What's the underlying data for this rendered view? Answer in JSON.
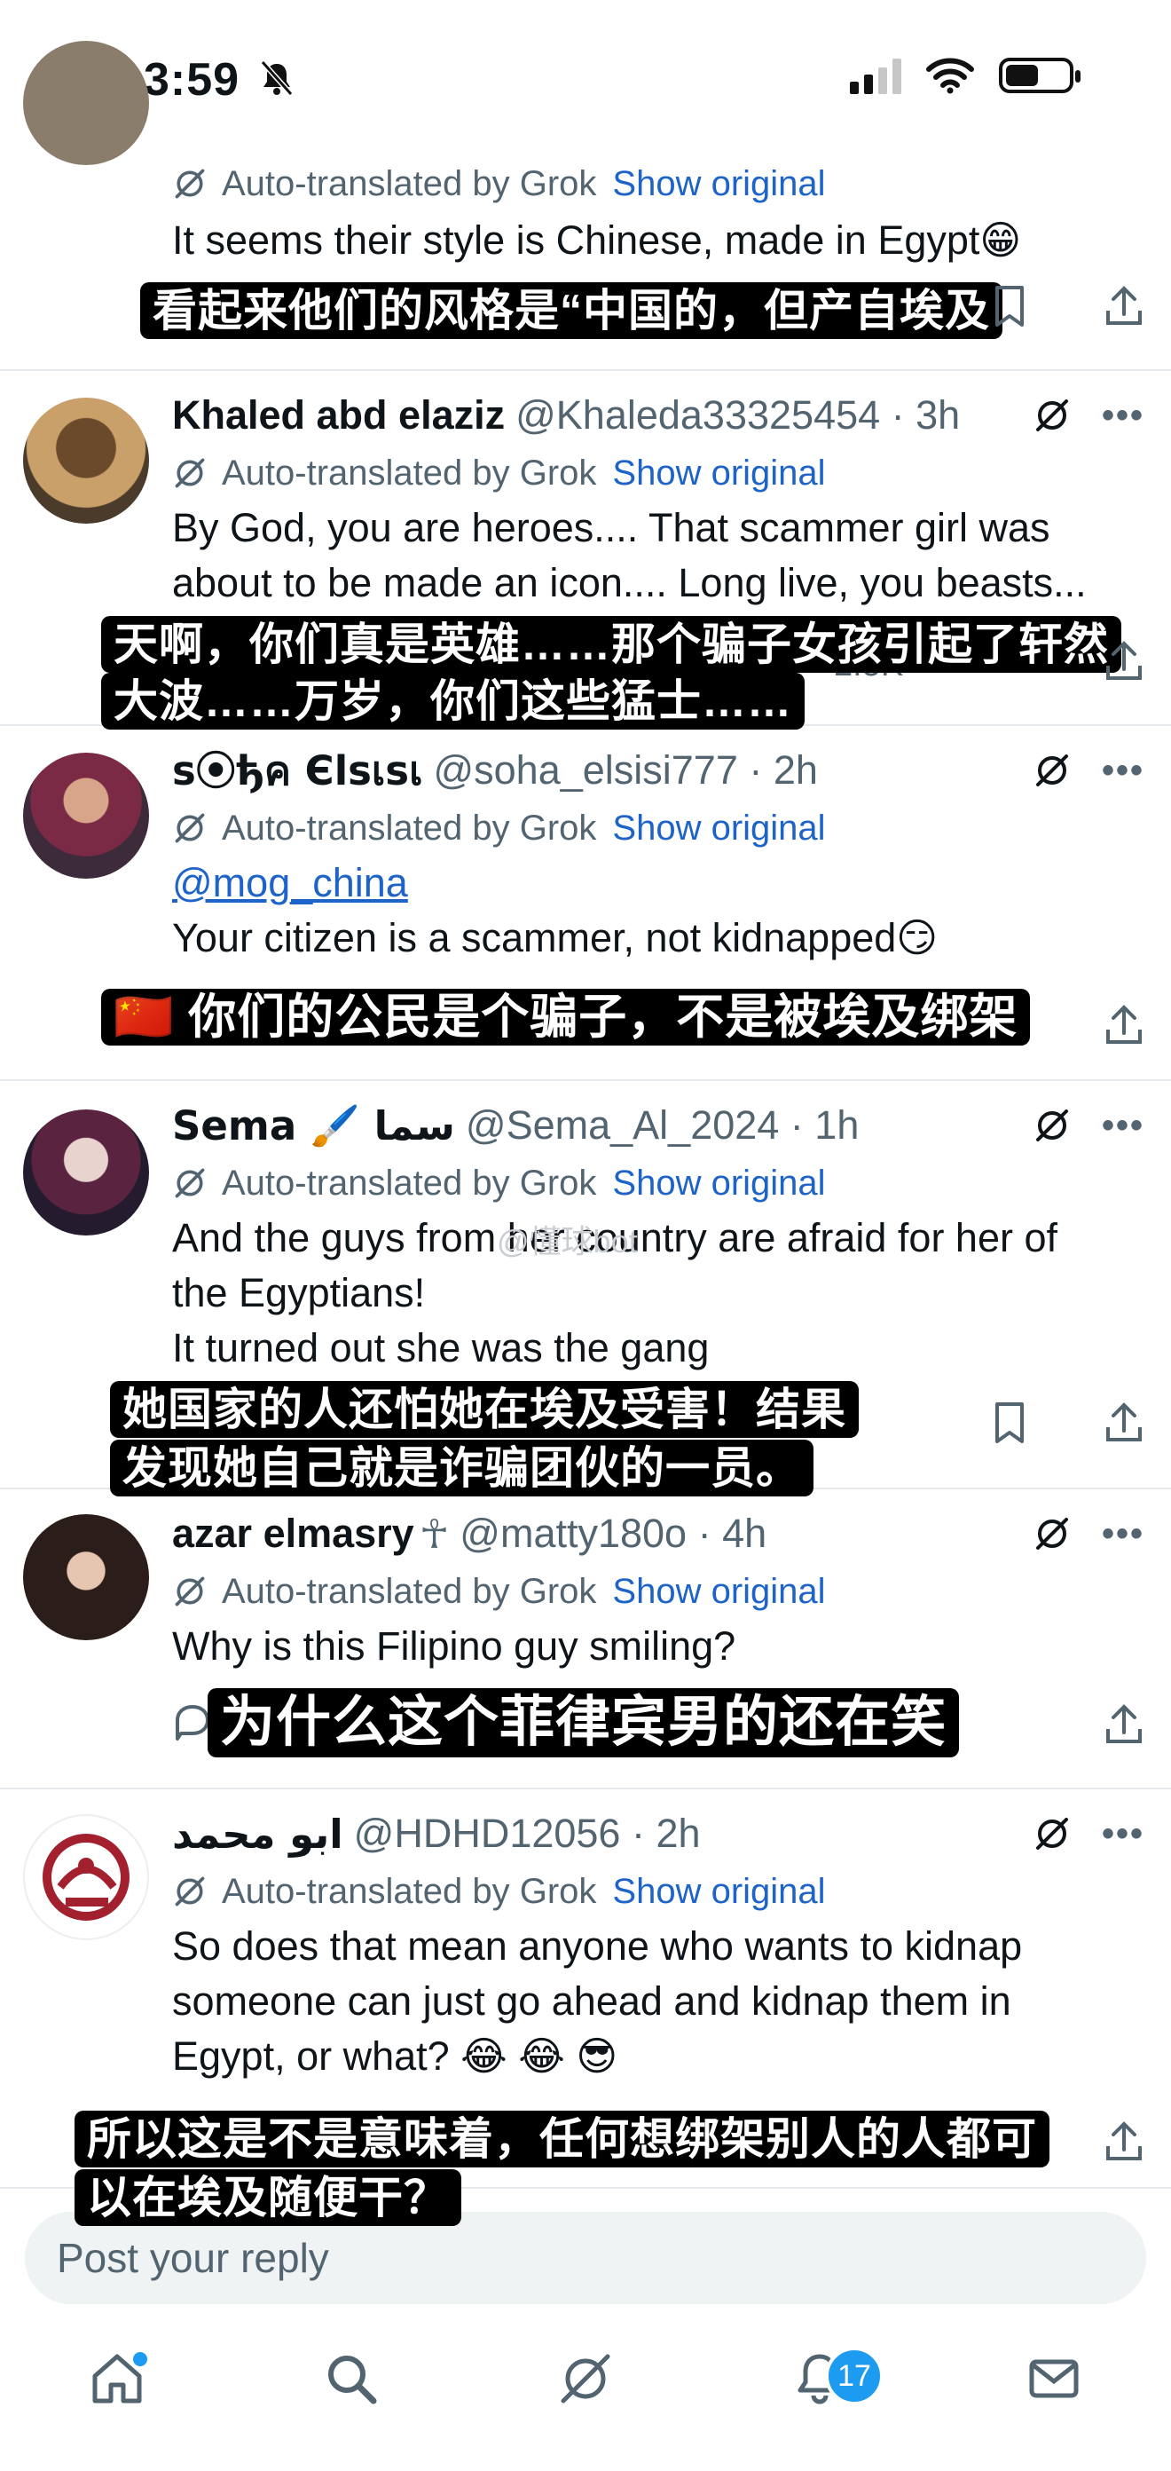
{
  "status_bar": {
    "time": "3:59"
  },
  "tweets": [
    {
      "name": "",
      "handle": "",
      "time": "",
      "auto_label": "Auto-translated by Grok",
      "show_original": "Show original",
      "body": [
        " It seems their style is Chinese, made in Egypt😁"
      ],
      "subtitle": [
        "看起来他们的风格是“中国的，但产自埃及"
      ]
    },
    {
      "name": "Khaled abd elaziz",
      "handle": "@Khaleda33325454 · 3h",
      "auto_label": "Auto-translated by Grok",
      "show_original": "Show original",
      "body": [
        " By God, you are heroes.... That scammer girl was",
        "about to be made an icon.... Long live, you beasts..."
      ],
      "subtitle": [
        "天啊，你们真是英雄……那个骗子女孩引起了轩然",
        "大波……万岁，你们这些猛士……"
      ],
      "views": "2.5K"
    },
    {
      "name": "s⦿ђค Єlsเsเ",
      "handle": "@soha_elsisi777 · 2h",
      "auto_label": "Auto-translated by Grok",
      "show_original": "Show original",
      "mention": "@mog_china",
      "body": [
        "Your citizen is a scammer, not kidnapped😏"
      ],
      "subtitle": [
        "🇨🇳 你们的公民是个骗子，不是被埃及绑架"
      ]
    },
    {
      "name": "Sema 🖌️ سما",
      "handle": "@Sema_Al_2024 · 1h",
      "auto_label": "Auto-translated by Grok",
      "show_original": "Show original",
      "body": [
        "And the guys from her country are afraid for her of",
        "the Egyptians!",
        "It turned out she was the gang"
      ],
      "subtitle": [
        "她国家的人还怕她在埃及受害！结果",
        "发现她自己就是诈骗团伙的一员。"
      ],
      "watermark": "@懂球bot"
    },
    {
      "name": "azar elmasry",
      "name_symbol": "☥",
      "handle": "@matty180o · 4h",
      "auto_label": "Auto-translated by Grok",
      "show_original": "Show original",
      "body": [
        "Why is this Filipino guy smiling?"
      ],
      "subtitle": [
        "为什么这个菲律宾男的还在笑"
      ]
    },
    {
      "name": "ابو محمد",
      "handle": "@HDHD12056 · 2h",
      "auto_label": "Auto-translated by Grok",
      "show_original": "Show original",
      "body": [
        "So does that mean anyone who wants to kidnap",
        "someone can just go ahead and kidnap them in",
        "Egypt, or what? 😂 😂 😎"
      ],
      "subtitle": [
        "所以这是不是意味着，任何想绑架别人的人都可",
        "以在埃及随便干？"
      ]
    }
  ],
  "reply": {
    "placeholder": "Post your reply"
  },
  "nav": {
    "items": [
      "home-icon",
      "search-icon",
      "grok-icon",
      "notifications-icon",
      "messages-icon"
    ],
    "notification_count": "17"
  },
  "colors": {
    "link": "#1d63c8",
    "accent": "#1d9bf0",
    "muted": "#536471"
  }
}
